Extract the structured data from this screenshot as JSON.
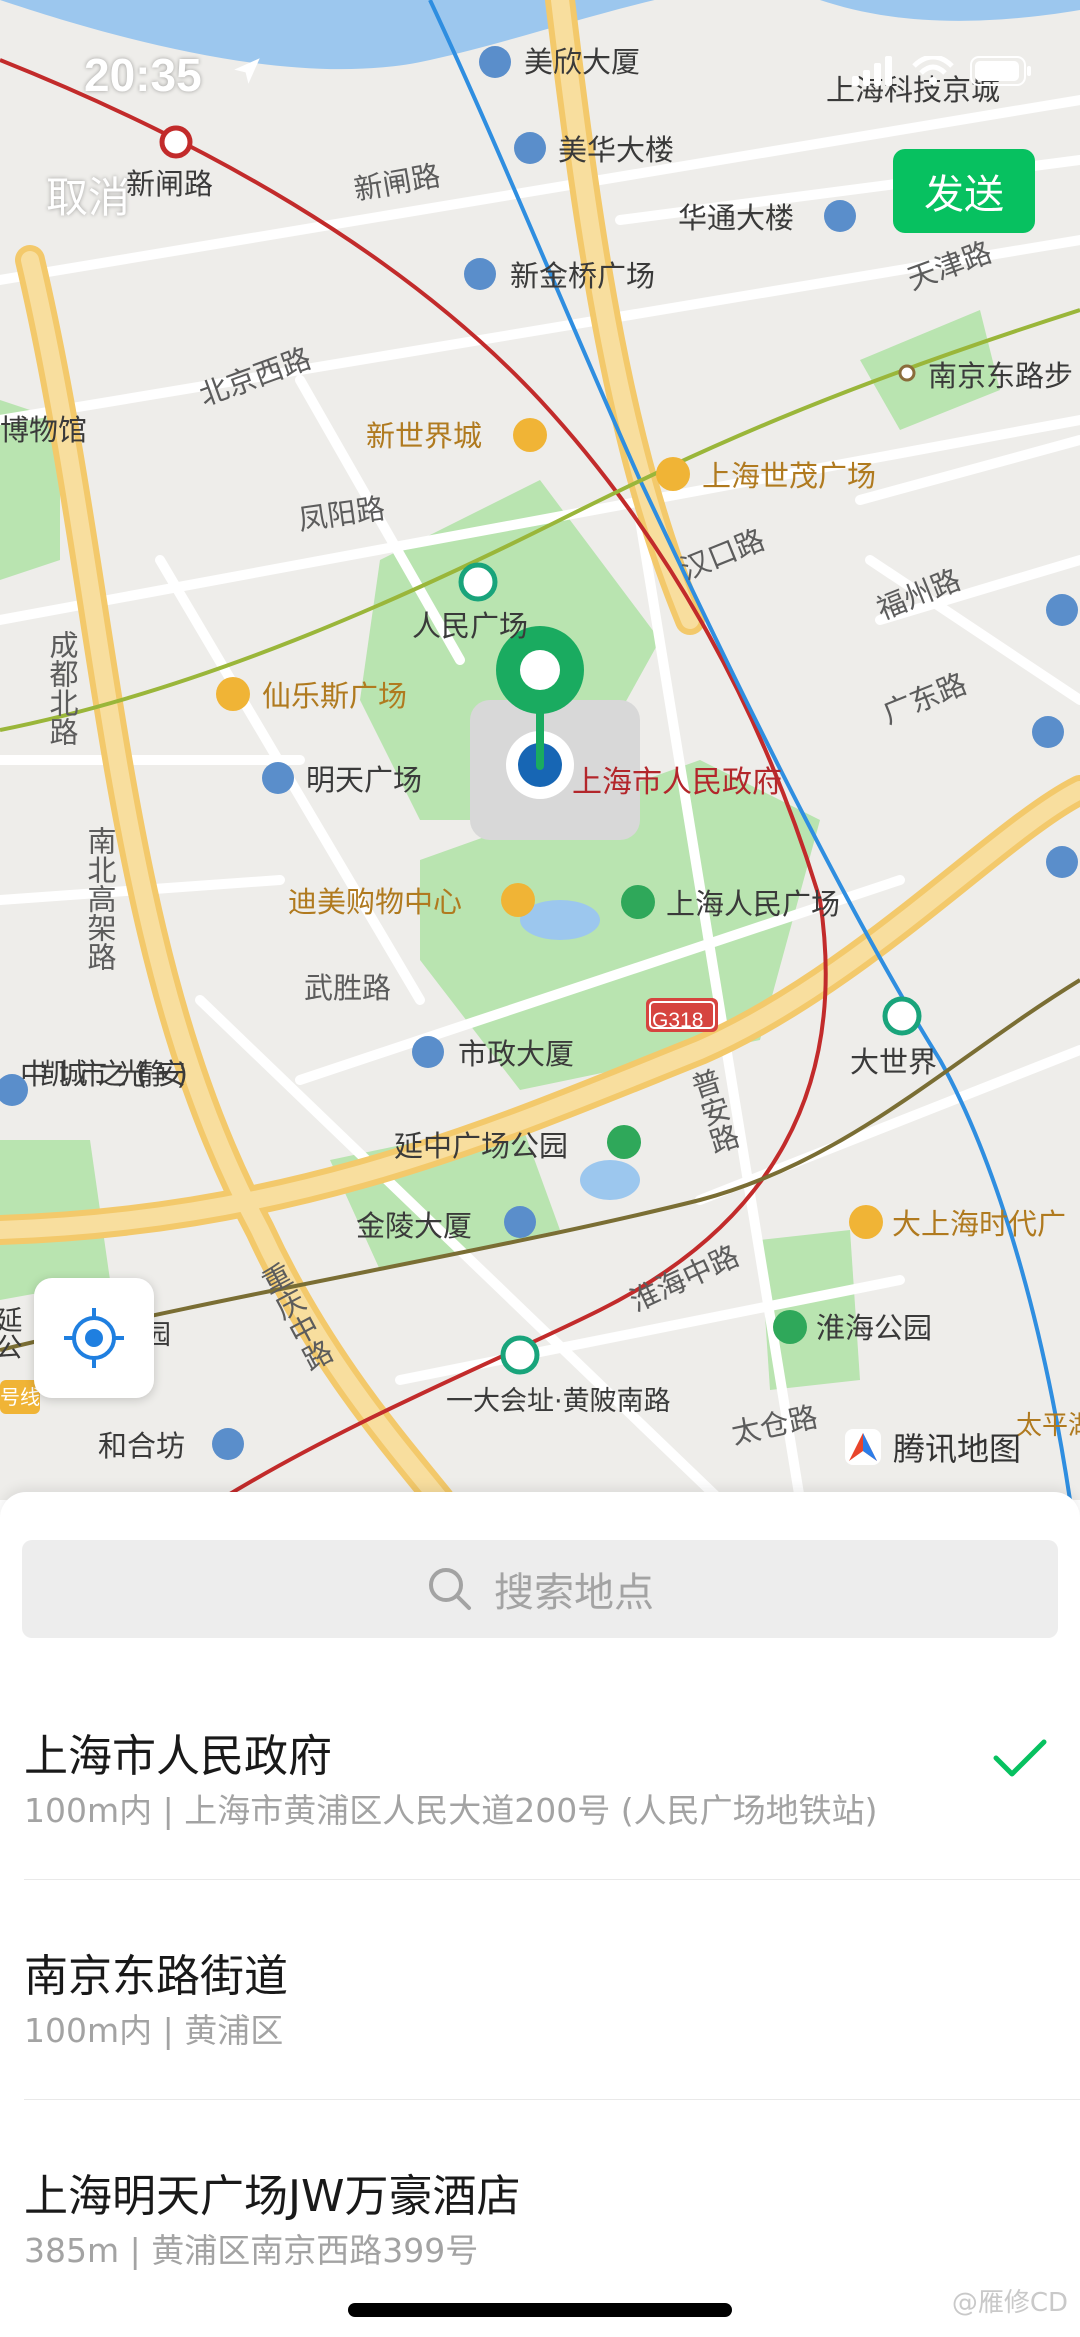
{
  "status_bar": {
    "time": "20:35"
  },
  "nav": {
    "cancel_label": "取消",
    "send_label": "发送"
  },
  "map": {
    "brand": "腾讯地图",
    "labels": {
      "meixin": "美欣大厦",
      "meihua": "美华大楼",
      "huatong": "华通大楼",
      "shanghai_keji": "上海科技京城",
      "xinzha_lu_top": "新闸路",
      "xinzha_lu": "新闸路",
      "xinjinqiao": "新金桥广场",
      "tianjin_lu": "天津路",
      "nanjing_east_station": "南京东路步",
      "beijing_west": "北京西路",
      "museum": "博物馆",
      "new_world": "新世界城",
      "shimao": "上海世茂广场",
      "fengyang": "凤阳路",
      "hankou": "汉口路",
      "fuzhou": "福州路",
      "peoples_square_station": "人民广场",
      "chengdu_north": "成都北路",
      "raffles": "仙乐斯广场",
      "guangdong": "广东路",
      "mingtian": "明天广场",
      "gov": "上海市人民政府",
      "nanbei": "南北高架路",
      "dimei": "迪美购物中心",
      "peoples_square_park": "上海人民广场",
      "wusheng": "武胜路",
      "g318": "G318",
      "dashijie": "大世界",
      "zhongkai": "中凯城市之光(静安)",
      "shizheng": "市政大厦",
      "puan": "普安路",
      "yanzhong": "延中广场公园",
      "dashanghai": "大上海时代广",
      "jinling": "金陵大厦",
      "chongqing": "重庆中路",
      "huaihai_road": "淮海中路",
      "huaihai_park": "淮海公园",
      "yidahui": "一大会址·黄陂南路",
      "taicang": "太仓路",
      "hehefang": "和合坊",
      "line_tag": "号线",
      "yan_left": "延公",
      "yuan": "园",
      "taiping": "太平湖",
      "shiwu": "之"
    }
  },
  "search": {
    "placeholder": "搜索地点"
  },
  "results": [
    {
      "name": "上海市人民政府",
      "address": "100m内 | 上海市黄浦区人民大道200号 (人民广场地铁站)",
      "selected": true
    },
    {
      "name": "南京东路街道",
      "address": "100m内 | 黄浦区",
      "selected": false
    },
    {
      "name": "上海明天广场JW万豪酒店",
      "address": "385m | 黄浦区南京西路399号",
      "selected": false
    }
  ],
  "watermark": "@雁修CD",
  "colors": {
    "accent": "#07C160",
    "map_land": "#EEEDEA",
    "park": "#B9E4B0",
    "road_major": "#F7D88B",
    "water": "#9CC7EE"
  }
}
